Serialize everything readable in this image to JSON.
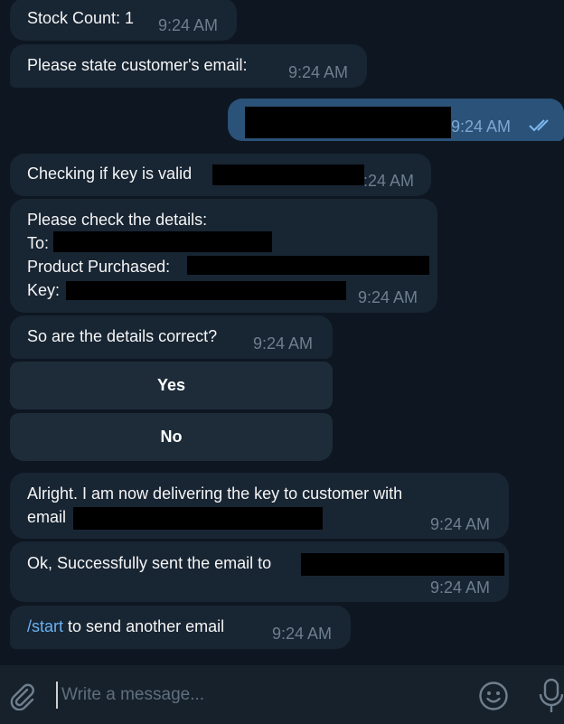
{
  "messages": {
    "stock": {
      "text": "Stock Count: 1",
      "time": "9:24 AM"
    },
    "ask_email": {
      "text": "Please state customer's email:",
      "time": "9:24 AM"
    },
    "outgoing": {
      "time": "9:24 AM",
      "status_icon": "double-check-icon"
    },
    "checking": {
      "text": "Checking if key is valid",
      "time": ":24 AM"
    },
    "details": {
      "line1": "Please check the details:",
      "line2": "To:",
      "line3": "Product Purchased:",
      "line4": "Key:",
      "time": "9:24 AM"
    },
    "confirm": {
      "text": "So are the details correct?",
      "time": "9:24 AM"
    },
    "keyboard": {
      "yes": "Yes",
      "no": "No"
    },
    "delivering": {
      "line1": "Alright. I am now delivering the key to customer with",
      "line2": "email",
      "time": "9:24 AM"
    },
    "sent": {
      "text": "Ok, Successfully sent the email to",
      "time": "9:24 AM"
    },
    "start": {
      "command": "/start",
      "text": " to send another email",
      "time": "9:24 AM"
    }
  },
  "composer": {
    "placeholder": "Write a message...",
    "icons": [
      "paperclip-icon",
      "emoji-icon",
      "microphone-icon"
    ]
  },
  "colors": {
    "background": "#0e1621",
    "incoming_bubble": "#182533",
    "outgoing_bubble": "#2b5278",
    "link": "#6ab3f3",
    "timestamp": "#6d7f8f"
  }
}
